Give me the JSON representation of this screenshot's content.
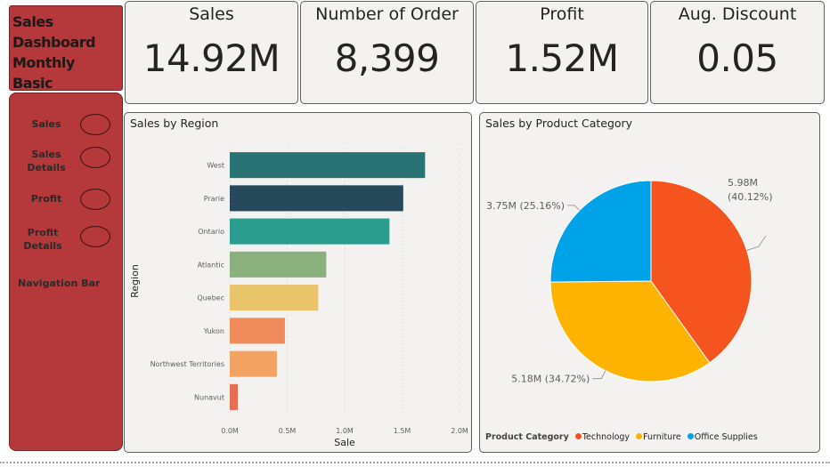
{
  "dashboard": {
    "title_lines": [
      "Sales",
      "Dashboard",
      "Monthly Basic"
    ]
  },
  "nav": {
    "items": [
      {
        "label_lines": [
          "Sales"
        ]
      },
      {
        "label_lines": [
          "Sales",
          "Details"
        ]
      },
      {
        "label_lines": [
          "Profit"
        ]
      },
      {
        "label_lines": [
          "Profit",
          "Details"
        ]
      }
    ],
    "caption": "Navigation Bar",
    "accent": "#b5383a"
  },
  "kpis": [
    {
      "title": "Sales",
      "value": "14.92M"
    },
    {
      "title": "Number of Order",
      "value": "8,399"
    },
    {
      "title": "Profit",
      "value": "1.52M"
    },
    {
      "title": "Aug. Discount",
      "value": "0.05"
    }
  ],
  "region_chart": {
    "title": "Sales by Region"
  },
  "category_chart": {
    "title": "Sales by Product Category",
    "legend_title": "Product Category"
  },
  "chart_data": [
    {
      "type": "bar",
      "orientation": "horizontal",
      "title": "Sales by Region",
      "xlabel": "Sale",
      "ylabel": "Region",
      "categories": [
        "West",
        "Prarie",
        "Ontario",
        "Atlantic",
        "Quebec",
        "Yukon",
        "Northwest Territories",
        "Nunavut"
      ],
      "values": [
        1.7,
        1.51,
        1.39,
        0.84,
        0.77,
        0.48,
        0.41,
        0.07
      ],
      "colors": [
        "#2a7374",
        "#26495c",
        "#2a9d8f",
        "#8ab17d",
        "#e9c46a",
        "#ef8a5b",
        "#f4a261",
        "#e76f51"
      ],
      "xlim": [
        0,
        2.0
      ],
      "xticks": [
        "0.0M",
        "0.5M",
        "1.0M",
        "1.5M",
        "2.0M"
      ],
      "tick_values": [
        0,
        0.5,
        1.0,
        1.5,
        2.0
      ],
      "grid": true
    },
    {
      "type": "pie",
      "title": "Sales by Product Category",
      "legend_title": "Product Category",
      "legend_position": "bottom-left",
      "series": [
        {
          "name": "Technology",
          "value": 5.98,
          "label": "5.98M",
          "percent": "(40.12%)",
          "color": "#f5541f"
        },
        {
          "name": "Furniture",
          "value": 5.18,
          "label": "5.18M",
          "percent": "(34.72%)",
          "color": "#fdb300"
        },
        {
          "name": "Office Supplies",
          "value": 3.75,
          "label": "3.75M",
          "percent": "(25.16%)",
          "color": "#00a3e8"
        }
      ],
      "data_labels": [
        "5.98M",
        "(40.12%)",
        "5.18M (34.72%)",
        "3.75M (25.16%)"
      ]
    }
  ]
}
